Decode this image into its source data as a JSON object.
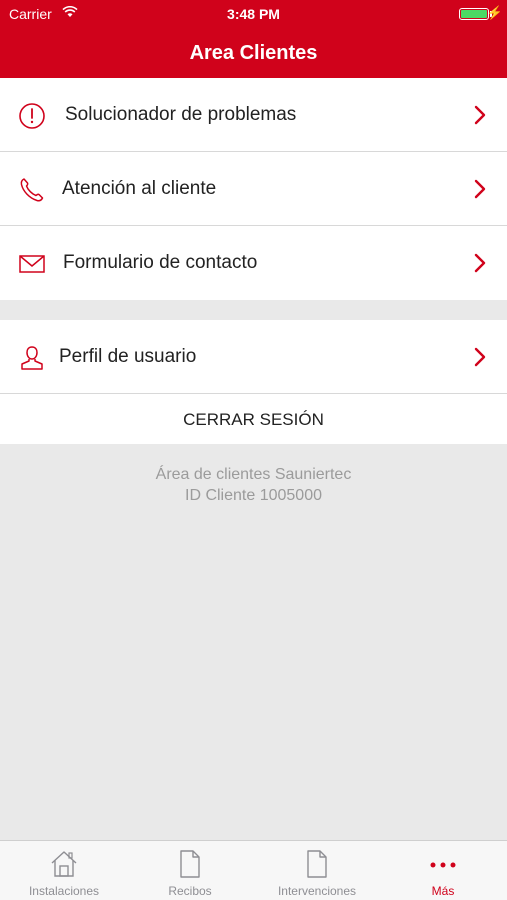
{
  "status_bar": {
    "carrier": "Carrier",
    "time": "3:48 PM",
    "wifi_icon": "wifi-icon",
    "battery_icon": "battery-full-icon",
    "charging_icon": "bolt-icon"
  },
  "header": {
    "title": "Area Clientes"
  },
  "menu": {
    "items": [
      {
        "label": "Solucionador de problemas",
        "icon": "alert-circle-icon"
      },
      {
        "label": "Atención al cliente",
        "icon": "phone-icon"
      },
      {
        "label": "Formulario de contacto",
        "icon": "envelope-icon"
      },
      {
        "label": "Perfil de usuario",
        "icon": "user-icon"
      }
    ],
    "logout_label": "CERRAR SESIÓN"
  },
  "footer": {
    "line1": "Área de clientes Sauniertec",
    "line2": "ID Cliente 1005000"
  },
  "tabbar": {
    "tabs": [
      {
        "label": "Instalaciones",
        "icon": "house-icon",
        "active": false
      },
      {
        "label": "Recibos",
        "icon": "document-icon",
        "active": false
      },
      {
        "label": "Intervenciones",
        "icon": "document-icon",
        "active": false
      },
      {
        "label": "Más",
        "icon": "more-dots-icon",
        "active": true
      }
    ]
  },
  "colors": {
    "brand_red": "#d0021b",
    "background": "#e9e9e9",
    "battery_green": "#4cd964",
    "footer_text": "#9b9b9b",
    "tab_inactive": "#8e8e93"
  }
}
